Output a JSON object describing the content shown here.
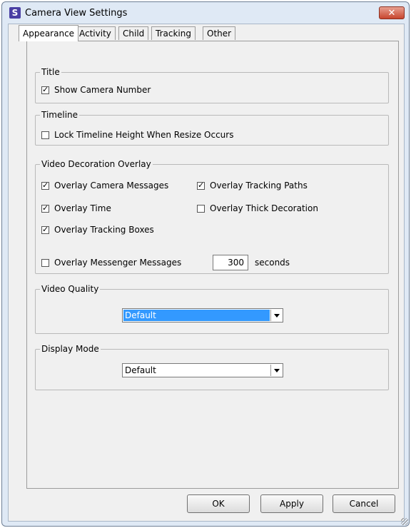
{
  "window": {
    "icon_letter": "S",
    "title": "Camera View Settings",
    "close_glyph": "✕"
  },
  "tabs": [
    {
      "label": "Appearance",
      "active": true
    },
    {
      "label": "Activity",
      "active": false
    },
    {
      "label": "Child",
      "active": false
    },
    {
      "label": "Tracking",
      "active": false
    },
    {
      "label": "Other",
      "active": false
    }
  ],
  "groups": {
    "title": {
      "label": "Title",
      "show_camera_number": {
        "label": "Show Camera Number",
        "checked": true
      }
    },
    "timeline": {
      "label": "Timeline",
      "lock_height": {
        "label": "Lock Timeline Height When Resize Occurs",
        "checked": false
      }
    },
    "overlay": {
      "label": "Video Decoration Overlay",
      "camera_messages": {
        "label": "Overlay Camera Messages",
        "checked": true
      },
      "tracking_paths": {
        "label": "Overlay Tracking Paths",
        "checked": true
      },
      "time": {
        "label": "Overlay Time",
        "checked": true
      },
      "thick_decoration": {
        "label": "Overlay Thick Decoration",
        "checked": false
      },
      "tracking_boxes": {
        "label": "Overlay Tracking Boxes",
        "checked": true
      },
      "messenger_messages": {
        "label": "Overlay Messenger Messages",
        "checked": false
      },
      "seconds_value": "300",
      "seconds_label": "seconds"
    },
    "video_quality": {
      "label": "Video Quality",
      "selected": "Default"
    },
    "display_mode": {
      "label": "Display Mode",
      "selected": "Default"
    }
  },
  "buttons": {
    "ok": "OK",
    "apply": "Apply",
    "cancel": "Cancel"
  },
  "colors": {
    "selection": "#3399ff",
    "close_button": "#c8462f",
    "title_background": "#dfe9f5"
  }
}
